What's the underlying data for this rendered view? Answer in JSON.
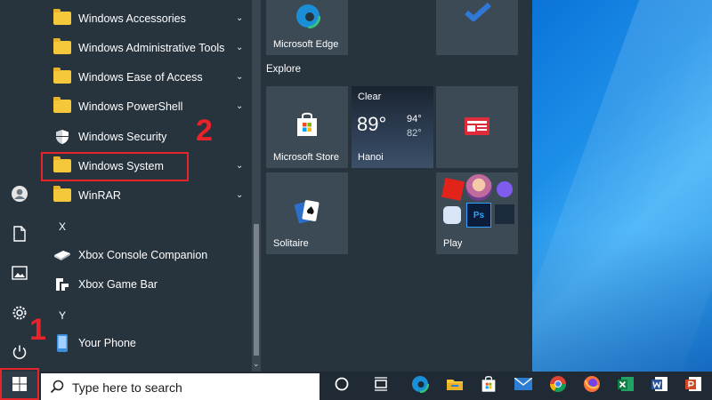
{
  "start_menu": {
    "app_list": [
      {
        "type": "app",
        "label": "Windows Accessories",
        "icon": "folder-icon",
        "chevron": "⌄"
      },
      {
        "type": "app",
        "label": "Windows Administrative Tools",
        "icon": "folder-icon",
        "chevron": "⌄"
      },
      {
        "type": "app",
        "label": "Windows Ease of Access",
        "icon": "folder-icon",
        "chevron": "⌄"
      },
      {
        "type": "app",
        "label": "Windows PowerShell",
        "icon": "folder-icon",
        "chevron": "⌄"
      },
      {
        "type": "app",
        "label": "Windows Security",
        "icon": "shield-icon"
      },
      {
        "type": "app",
        "label": "Windows System",
        "icon": "folder-icon",
        "chevron": "⌄"
      },
      {
        "type": "app",
        "label": "WinRAR",
        "icon": "folder-icon",
        "chevron": "⌄"
      },
      {
        "type": "letter",
        "label": "X"
      },
      {
        "type": "app",
        "label": "Xbox Console Companion",
        "icon": "xbox-console-icon"
      },
      {
        "type": "app",
        "label": "Xbox Game Bar",
        "icon": "xbox-game-bar-icon"
      },
      {
        "type": "letter",
        "label": "Y"
      },
      {
        "type": "app",
        "label": "Your Phone",
        "icon": "phone-icon"
      }
    ],
    "tiles": {
      "group_title": "Explore",
      "edge": {
        "label": "Microsoft Edge"
      },
      "store": {
        "label": "Microsoft Store"
      },
      "weather": {
        "condition": "Clear",
        "temp": "89°",
        "high": "94°",
        "low": "82°",
        "city": "Hanoi"
      },
      "solitaire": {
        "label": "Solitaire"
      },
      "play": {
        "label": "Play"
      }
    }
  },
  "taskbar": {
    "search_placeholder": "Type here to search"
  },
  "annotations": {
    "step1": "1",
    "step2": "2"
  },
  "colors": {
    "annotation_red": "#e8232a",
    "folder_yellow": "#f5c73a",
    "menu_bg": "#27333d",
    "tile_bg": "#3c4a55"
  }
}
